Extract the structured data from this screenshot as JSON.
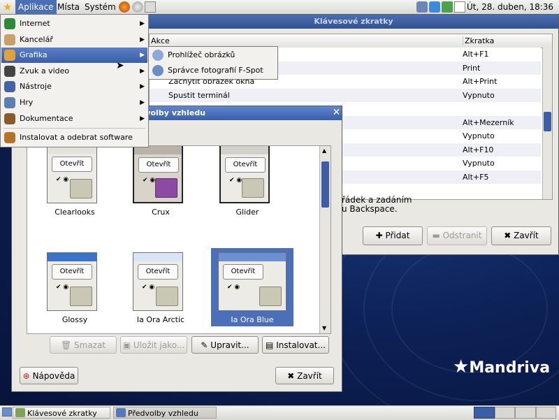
{
  "top_panel": {
    "menus": [
      "Aplikace",
      "Místa",
      "Systém"
    ],
    "clock": "Út, 28. duben, 18:36"
  },
  "applications_menu": {
    "items": [
      {
        "label": "Internet",
        "icon": "globe-icon",
        "submenu": true
      },
      {
        "label": "Kancelář",
        "icon": "office-icon",
        "submenu": true
      },
      {
        "label": "Grafika",
        "icon": "palette-icon",
        "submenu": true,
        "selected": true
      },
      {
        "label": "Zvuk a video",
        "icon": "multimedia-icon",
        "submenu": true
      },
      {
        "label": "Nástroje",
        "icon": "tools-icon",
        "submenu": true
      },
      {
        "label": "Hry",
        "icon": "games-icon",
        "submenu": true
      },
      {
        "label": "Dokumentace",
        "icon": "book-icon",
        "submenu": true
      },
      {
        "label": "Instalovat a odebrat software",
        "icon": "package-icon",
        "submenu": false
      }
    ]
  },
  "graphics_submenu": {
    "items": [
      {
        "label": "Prohlížeč obrázků",
        "icon": "image-viewer-icon"
      },
      {
        "label": "Správce fotografií F-Spot",
        "icon": "f-spot-icon"
      }
    ]
  },
  "shortcuts_window": {
    "title": "Klávesové zkratky",
    "columns": [
      "Akce",
      "Zkratka"
    ],
    "rows": [
      {
        "action": "",
        "key": "Alt+F1"
      },
      {
        "action": "",
        "key": "Print"
      },
      {
        "action": "Zachytit obrázek okna",
        "key": "Alt+Print"
      },
      {
        "action": "Spustit terminál",
        "key": "Vypnuto"
      },
      {
        "action": "",
        "key": ""
      },
      {
        "action": "",
        "key": "Alt+Mezerník"
      },
      {
        "action": "",
        "key": "Vypnuto"
      },
      {
        "action": "",
        "key": "Alt+F10"
      },
      {
        "action": "",
        "key": "Vypnuto"
      },
      {
        "action": "",
        "key": "Alt+F5"
      }
    ],
    "hint_line1": "řádek a zadáním",
    "hint_line2": "u Backspace.",
    "add_button": "Přidat",
    "remove_button": "Odstranit",
    "close_button": "Zavřít"
  },
  "appearance_window": {
    "title": "edvolby vzhledu",
    "themes": [
      {
        "name": "Clearlooks",
        "button": "Otevřít"
      },
      {
        "name": "Crux",
        "button": "Otevřít"
      },
      {
        "name": "Glider",
        "button": "Otevřít"
      },
      {
        "name": "Glossy",
        "button": "Otevřít"
      },
      {
        "name": "Ia Ora Arctic",
        "button": "Otevřít"
      },
      {
        "name": "Ia Ora Blue",
        "button": "Otevřít",
        "selected": true
      }
    ],
    "delete_button": "Smazat",
    "save_as_button": "Uložit jako...",
    "edit_button": "Upravit...",
    "install_button": "Instalovat...",
    "help_button": "Nápověda",
    "close_button": "Zavřít"
  },
  "desktop": {
    "logo_text": "Mandriva"
  },
  "taskbar": {
    "tasks": [
      "Klávesové zkratky",
      "Předvolby vzhledu"
    ]
  }
}
